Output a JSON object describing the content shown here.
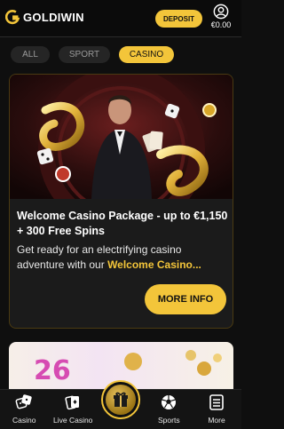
{
  "header": {
    "brand": "GOLDIWIN",
    "deposit_label": "DEPOSIT",
    "balance": "€0.00"
  },
  "tabs": [
    {
      "label": "ALL",
      "active": false
    },
    {
      "label": "SPORT",
      "active": false
    },
    {
      "label": "CASINO",
      "active": true
    }
  ],
  "promo": {
    "title": "Welcome Casino Package - up to €1,150 + 300 Free Spins",
    "description": "Get ready for an electrifying casino adventure with our ",
    "description_highlight": "Welcome Casino...",
    "button_label": "MORE INFO"
  },
  "banner2": {
    "number": "26"
  },
  "bottom_nav": [
    {
      "label": "Casino",
      "icon": "dice-icon"
    },
    {
      "label": "Live Casino",
      "icon": "cards-icon"
    },
    {
      "label": "",
      "icon": "gift-icon"
    },
    {
      "label": "Sports",
      "icon": "soccer-ball-icon"
    },
    {
      "label": "More",
      "icon": "menu-icon"
    }
  ],
  "colors": {
    "accent": "#f3c53a",
    "background": "#0f0f0f",
    "card": "#1b1b1b"
  }
}
